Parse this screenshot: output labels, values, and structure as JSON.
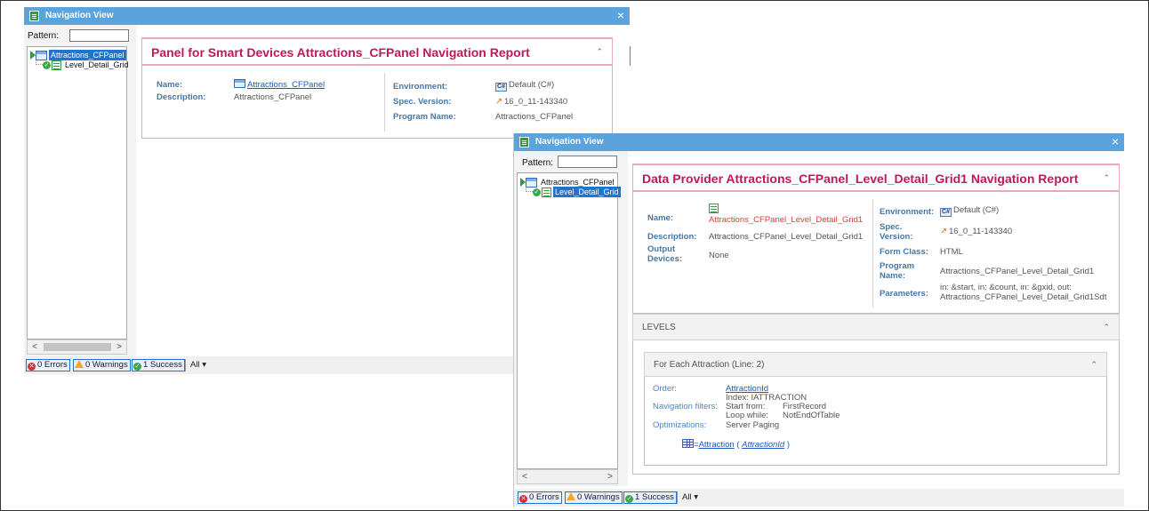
{
  "window1": {
    "title": "Navigation View",
    "close_glyph": "×",
    "pattern_label": "Pattern:",
    "tree": [
      {
        "label": "Attractions_CFPanel",
        "selected": true
      },
      {
        "label": "Level_Detail_Grid",
        "selected": false
      }
    ],
    "report_title": "Panel for Smart Devices Attractions_CFPanel Navigation Report",
    "collapse_glyph": "⌃",
    "fields_left": [
      {
        "label": "Name:",
        "value": "Attractions_CFPanel"
      },
      {
        "label": "Description:",
        "value": "Attractions_CFPanel"
      }
    ],
    "fields_right": [
      {
        "label": "Environment:",
        "value": "Default (C#)"
      },
      {
        "label": "Spec. Version:",
        "value": "16_0_11-143340"
      },
      {
        "label": "Program Name:",
        "value": "Attractions_CFPanel"
      }
    ],
    "status": {
      "errors": "0 Errors",
      "warnings": "0 Warnings",
      "success": "1 Success",
      "filter": "All ▾"
    }
  },
  "window2": {
    "title": "Navigation View",
    "close_glyph": "×",
    "pattern_label": "Pattern:",
    "tree": [
      {
        "label": "Attractions_CFPanel",
        "selected": false
      },
      {
        "label": "Level_Detail_Grid",
        "selected": true
      }
    ],
    "report_title": "Data Provider Attractions_CFPanel_Level_Detail_Grid1 Navigation Report",
    "collapse_glyph": "⌃",
    "fields_left": [
      {
        "label": "Name:",
        "value": "Attractions_CFPanel_Level_Detail_Grid1"
      },
      {
        "label": "Description:",
        "value": "Attractions_CFPanel_Level_Detail_Grid1"
      },
      {
        "label": "Output Devices:",
        "value": "None"
      }
    ],
    "fields_right": [
      {
        "label": "Environment:",
        "value": "Default (C#)"
      },
      {
        "label": "Spec. Version:",
        "value": "16_0_11-143340"
      },
      {
        "label": "Form Class:",
        "value": "HTML"
      },
      {
        "label": "Program Name:",
        "value": "Attractions_CFPanel_Level_Detail_Grid1"
      },
      {
        "label": "Parameters:",
        "value_line1": "in: &start, in: &count, in: &gxid, out:",
        "value_line2": "Attractions_CFPanel_Level_Detail_Grid1Sdt"
      }
    ],
    "levels_title": "LEVELS",
    "level": {
      "title": "For Each Attraction (Line: 2)",
      "order_label": "Order:",
      "order_value": "AttractionId",
      "index_text": "Index: IATTRACTION",
      "nav_filters_label": "Navigation filters:",
      "start_from_label": "Start from:",
      "start_from_value": "FirstRecord",
      "loop_while_label": "Loop while:",
      "loop_while_value": "NotEndOfTable",
      "optimizations_label": "Optimizations:",
      "optimizations_value": "Server Paging",
      "table_eq": "=",
      "table_name": "Attraction",
      "table_paren_open": " ( ",
      "table_key": "AttractionId",
      "table_paren_close": " )"
    },
    "status": {
      "errors": "0 Errors",
      "warnings": "0 Warnings",
      "success": "1 Success",
      "filter": "All ▾"
    }
  },
  "scroll": {
    "left_arrow": "<",
    "right_arrow": ">"
  },
  "icons": {
    "app": "navigation-view-icon",
    "panel": "panel-object-icon",
    "data_provider": "data-provider-icon",
    "csharp": "csharp-icon",
    "wand": "spec-version-icon",
    "table": "table-icon"
  },
  "colors": {
    "title_bar": "#5ba3dc",
    "report_title": "#c2185b",
    "label_blue": "#4477aa",
    "link_blue": "#1a5bb8",
    "selection": "#1e74d2",
    "error_red": "#e53935"
  }
}
